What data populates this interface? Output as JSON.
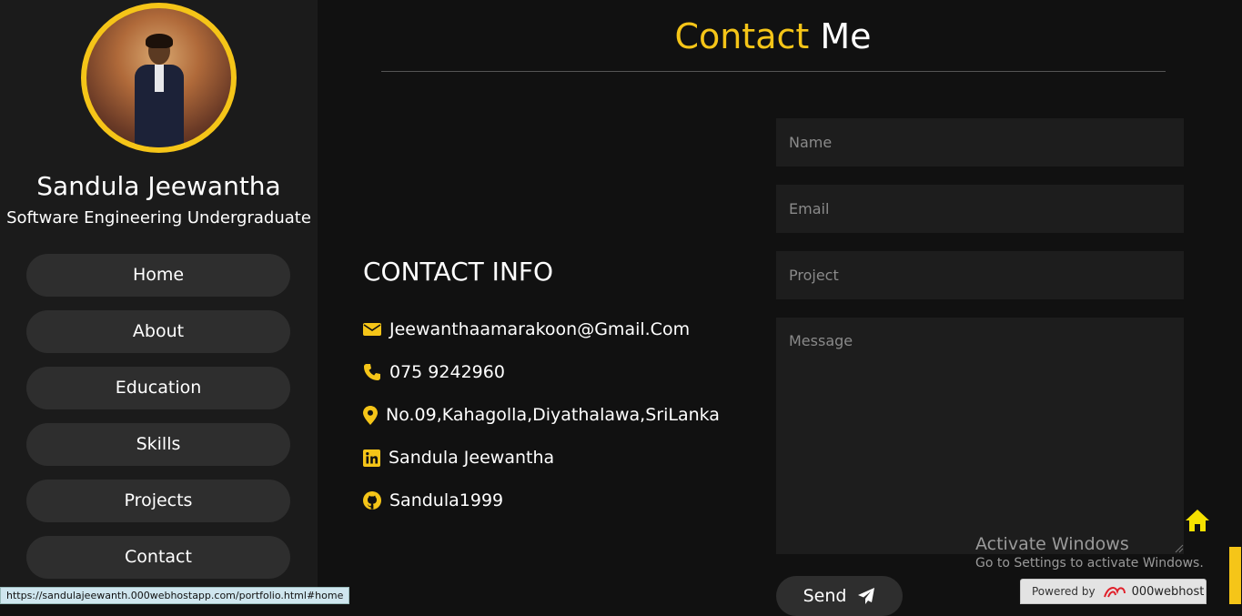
{
  "profile": {
    "name": "Sandula Jeewantha",
    "title": "Software Engineering Undergraduate"
  },
  "nav": {
    "items": [
      {
        "label": "Home"
      },
      {
        "label": "About"
      },
      {
        "label": "Education"
      },
      {
        "label": "Skills"
      },
      {
        "label": "Projects"
      },
      {
        "label": "Contact"
      }
    ]
  },
  "section": {
    "heading_accent": "Contact",
    "heading_rest": "Me"
  },
  "contact_info": {
    "title": "CONTACT INFO",
    "email": "Jeewanthaamarakoon@Gmail.Com",
    "phone": "075 9242960",
    "address": "No.09,Kahagolla,Diyathalawa,SriLanka",
    "linkedin": "Sandula Jeewantha",
    "github": "Sandula1999"
  },
  "form": {
    "name_placeholder": "Name",
    "email_placeholder": "Email",
    "project_placeholder": "Project",
    "message_placeholder": "Message",
    "send_label": "Send"
  },
  "overlay": {
    "activate_title": "Activate Windows",
    "activate_sub": "Go to Settings to activate Windows.",
    "status_url": "https://sandulajeewanth.000webhostapp.com/portfolio.html#home",
    "powered_by": "Powered by",
    "host_brand": "000webhost"
  },
  "colors": {
    "accent": "#f5c518",
    "sidebar_bg": "#1b1b1b",
    "main_bg": "#111111",
    "button_bg": "#2e2e2e",
    "field_bg": "#1d1d1d"
  }
}
